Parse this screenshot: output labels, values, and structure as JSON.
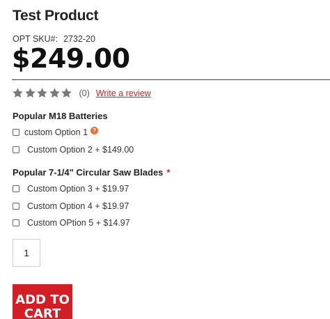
{
  "product": {
    "title": "Test Product",
    "sku_label": "OPT SKU#:",
    "sku_value": "2732-20",
    "price": "$249.00"
  },
  "rating": {
    "stars": 5,
    "filled_stars": 0,
    "count_text": "(0)",
    "write_review_label": "Write a review"
  },
  "option_groups": [
    {
      "title": "Popular M18 Batteries",
      "required": false,
      "options": [
        {
          "label": "custom Option 1",
          "has_help_icon": true,
          "checked": false
        },
        {
          "label": "Custom Option 2 + $149.00",
          "checked": false
        }
      ]
    },
    {
      "title": "Popular 7-1/4\" Circular Saw Blades",
      "required": true,
      "required_mark": "*",
      "options": [
        {
          "label": "Custom Option 3 + $19.97",
          "checked": false
        },
        {
          "label": "Custom Option 4 + $19.97",
          "checked": false
        },
        {
          "label": "Custom OPtion 5 + $14.97",
          "checked": false
        }
      ]
    }
  ],
  "help_icon_glyph": "?",
  "quantity": "1",
  "add_to_cart_label": "ADD TO CART",
  "colors": {
    "accent": "#d21f26",
    "star": "#7a7a7a",
    "help_icon": "#e9703a"
  }
}
